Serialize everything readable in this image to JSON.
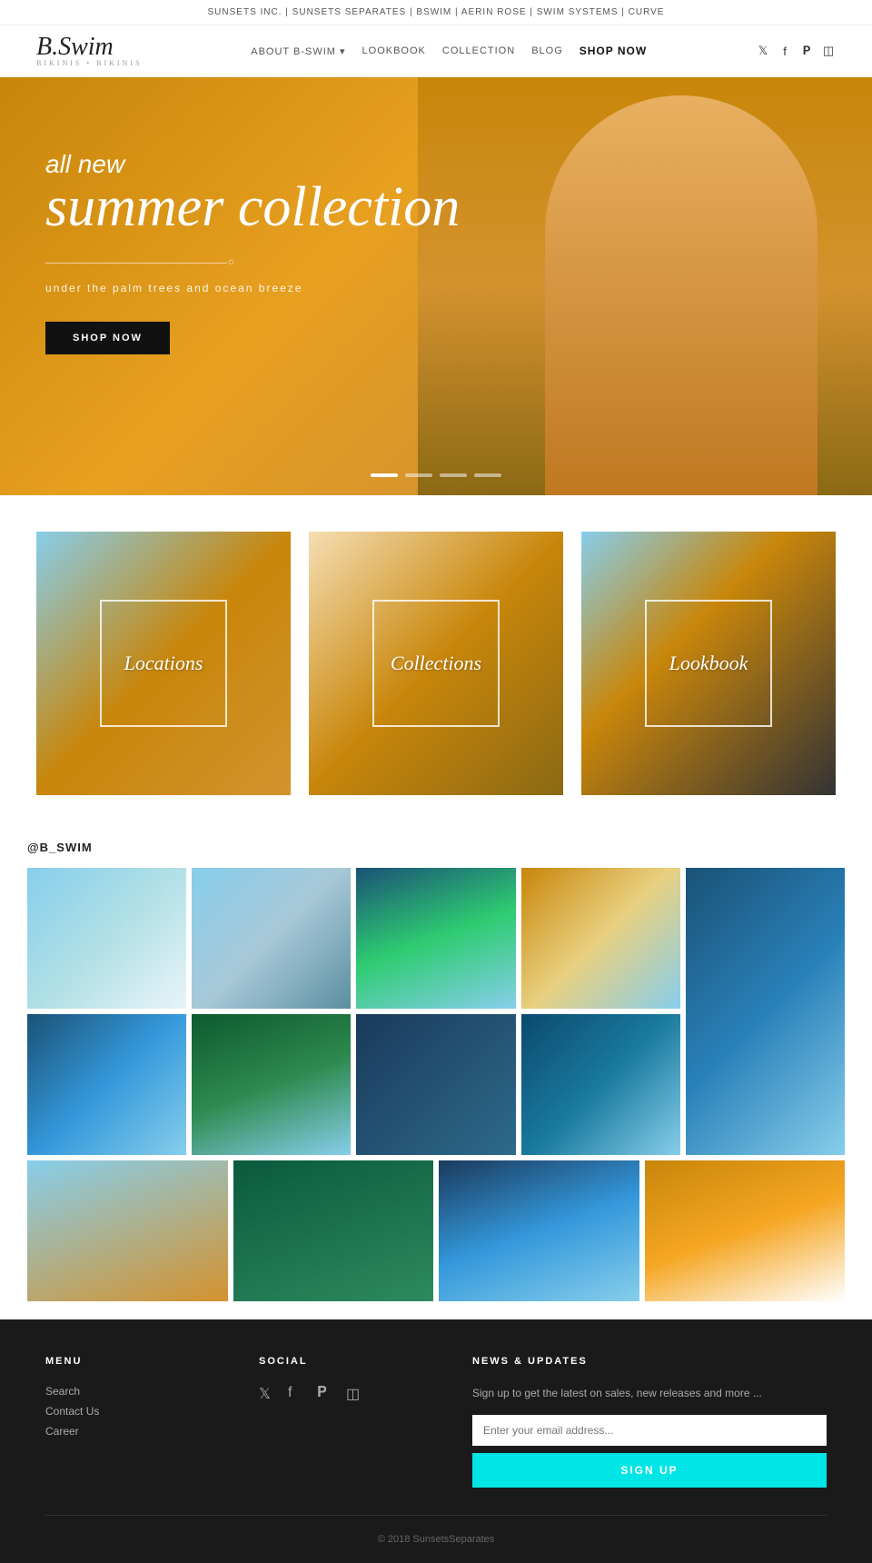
{
  "topbar": {
    "text": "SUNSETS INC. | SUNSETS SEPARATES | BSWIM | AERIN ROSE | SWIM SYSTEMS | CURVE"
  },
  "header": {
    "logo": "B.Swim",
    "logo_sub": "BIKINIS • BIKINIS",
    "nav": [
      {
        "label": "ABOUT B-SWIM ▾",
        "active": false
      },
      {
        "label": "LOOKBOOK",
        "active": false
      },
      {
        "label": "COLLECTION",
        "active": false
      },
      {
        "label": "BLOG",
        "active": false
      },
      {
        "label": "SHOP NOW",
        "active": true
      }
    ]
  },
  "hero": {
    "tag": "all new",
    "title": "summer collection",
    "subtitle": "under the palm trees and ocean breeze",
    "cta": "SHOP NOW",
    "dots": [
      "active",
      "inactive",
      "inactive",
      "inactive"
    ]
  },
  "categories": [
    {
      "label": "Locations",
      "bg": "locations"
    },
    {
      "label": "Collections",
      "bg": "collections"
    },
    {
      "label": "Lookbook",
      "bg": "lookbook"
    }
  ],
  "instagram": {
    "handle": "@B_SWIM",
    "images": [
      {
        "bg": "ig-bg-1"
      },
      {
        "bg": "ig-bg-2"
      },
      {
        "bg": "ig-bg-3"
      },
      {
        "bg": "ig-bg-4"
      },
      {
        "bg": "ig-bg-5",
        "tall": true
      },
      {
        "bg": "ig-bg-6"
      },
      {
        "bg": "ig-bg-7"
      },
      {
        "bg": "ig-bg-8"
      },
      {
        "bg": "ig-bg-9"
      },
      {
        "bg": "ig-bg-10"
      },
      {
        "bg": "ig-bg-11"
      },
      {
        "bg": "ig-bg-12"
      },
      {
        "bg": "ig-bg-13"
      },
      {
        "bg": "ig-bg-14"
      }
    ]
  },
  "footer": {
    "menu": {
      "title": "MENU",
      "items": [
        "Search",
        "Contact Us",
        "Career"
      ]
    },
    "social": {
      "title": "SOCIAL",
      "icons": [
        "twitter",
        "facebook",
        "pinterest",
        "instagram"
      ]
    },
    "news": {
      "title": "NEWS & UPDATES",
      "description": "Sign up to get the latest on sales, new releases and more ...",
      "email_placeholder": "Enter your email address...",
      "signup_label": "SIGN UP"
    },
    "copyright": "© 2018 SunsetsSeparates"
  }
}
